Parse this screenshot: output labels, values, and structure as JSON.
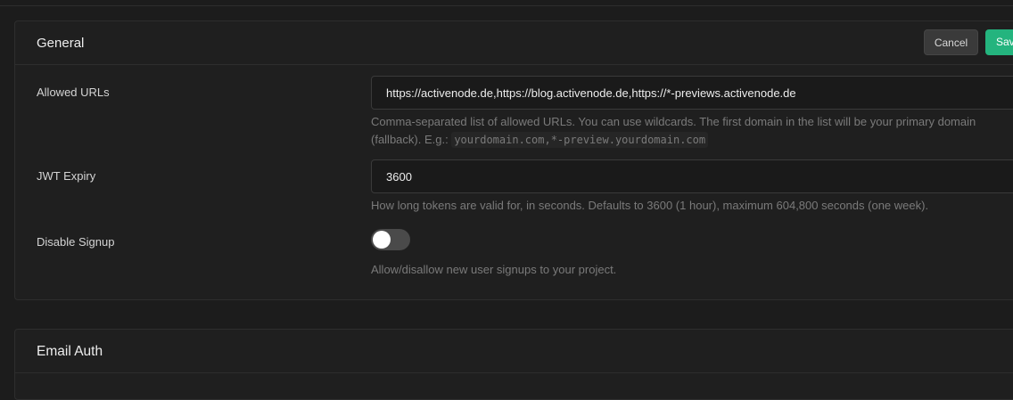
{
  "general": {
    "title": "General",
    "cancel_label": "Cancel",
    "save_label": "Save",
    "allowed_urls": {
      "label": "Allowed URLs",
      "value": "https://activenode.de,https://blog.activenode.de,https://*-previews.activenode.de",
      "help_text": "Comma-separated list of allowed URLs. You can use wildcards. The first domain in the list will be your primary domain (fallback). E.g.:",
      "help_example": "yourdomain.com,*-preview.yourdomain.com"
    },
    "jwt_expiry": {
      "label": "JWT Expiry",
      "value": "3600",
      "help_text": "How long tokens are valid for, in seconds. Defaults to 3600 (1 hour), maximum 604,800 seconds (one week)."
    },
    "disable_signup": {
      "label": "Disable Signup",
      "enabled": false,
      "help_text": "Allow/disallow new user signups to your project."
    }
  },
  "email_auth": {
    "title": "Email Auth"
  }
}
